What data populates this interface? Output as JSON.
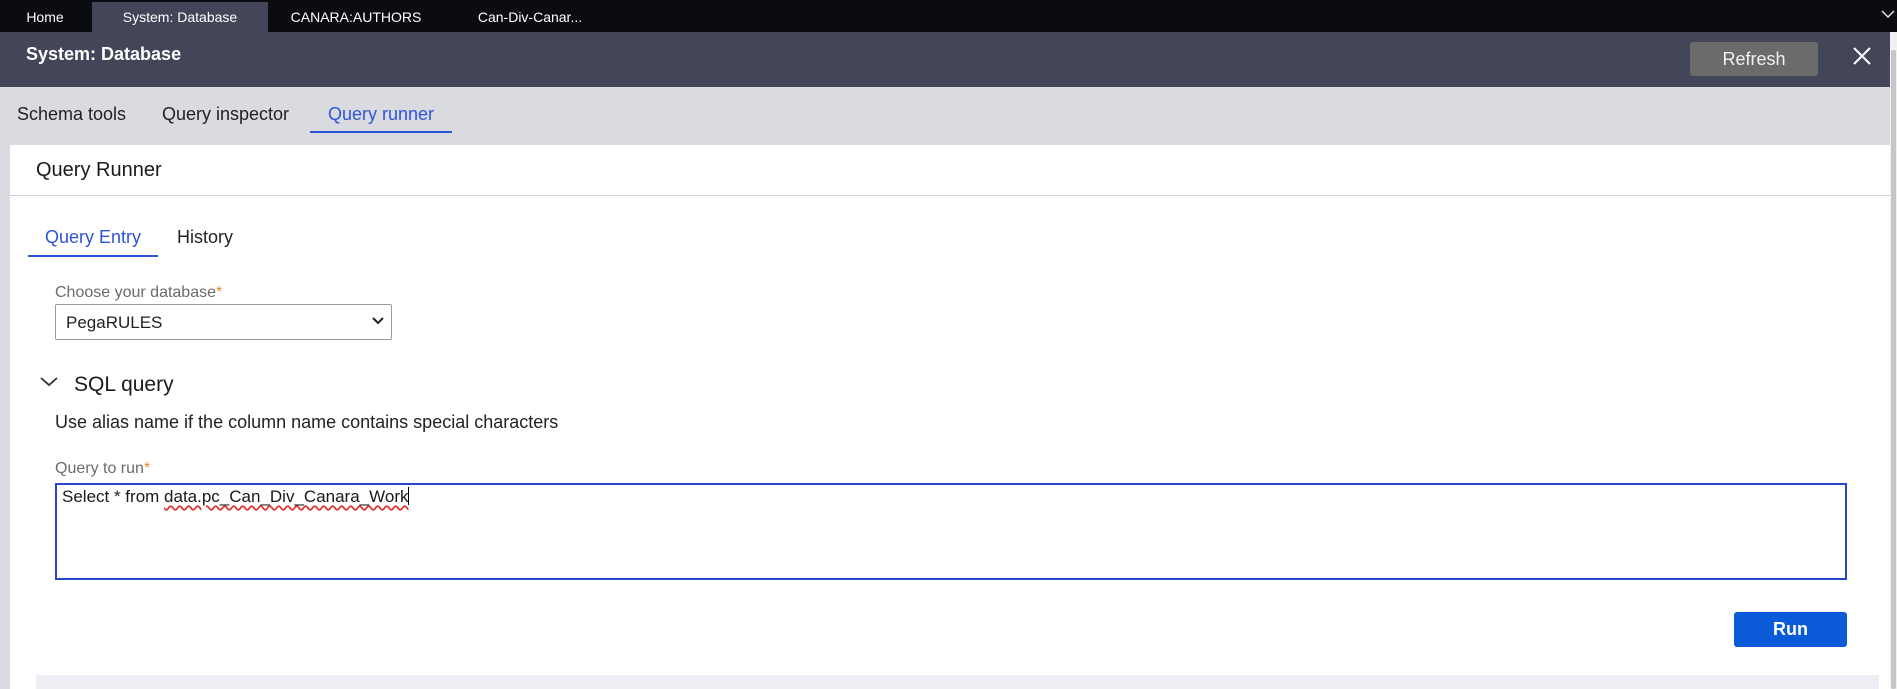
{
  "top_tabs": [
    {
      "label": "Home",
      "active": false
    },
    {
      "label": "System: Database",
      "active": true
    },
    {
      "label": "CANARA:AUTHORS",
      "active": false
    },
    {
      "label": "Can-Div-Canar...",
      "active": false
    }
  ],
  "header": {
    "title": "System: Database",
    "refresh_label": "Refresh",
    "close_icon": "close-icon"
  },
  "sub_tabs": [
    {
      "label": "Schema tools",
      "active": false
    },
    {
      "label": "Query inspector",
      "active": false
    },
    {
      "label": "Query runner",
      "active": true
    }
  ],
  "panel": {
    "title": "Query Runner",
    "inner_tabs": [
      {
        "label": "Query Entry",
        "active": true
      },
      {
        "label": "History",
        "active": false
      }
    ],
    "database_label": "Choose your database",
    "required_mark": "*",
    "database_value": "PegaRULES",
    "section_title": "SQL query",
    "section_help": "Use alias name if the column name contains special characters",
    "query_label": "Query to run",
    "query_prefix": "Select * from ",
    "query_table": "data.pc_Can_Div_Canara_Work",
    "run_label": "Run"
  },
  "colors": {
    "accent": "#2e55d6",
    "header_bg": "#434658",
    "run_button": "#0b5bd8",
    "required": "#e08a2e"
  }
}
